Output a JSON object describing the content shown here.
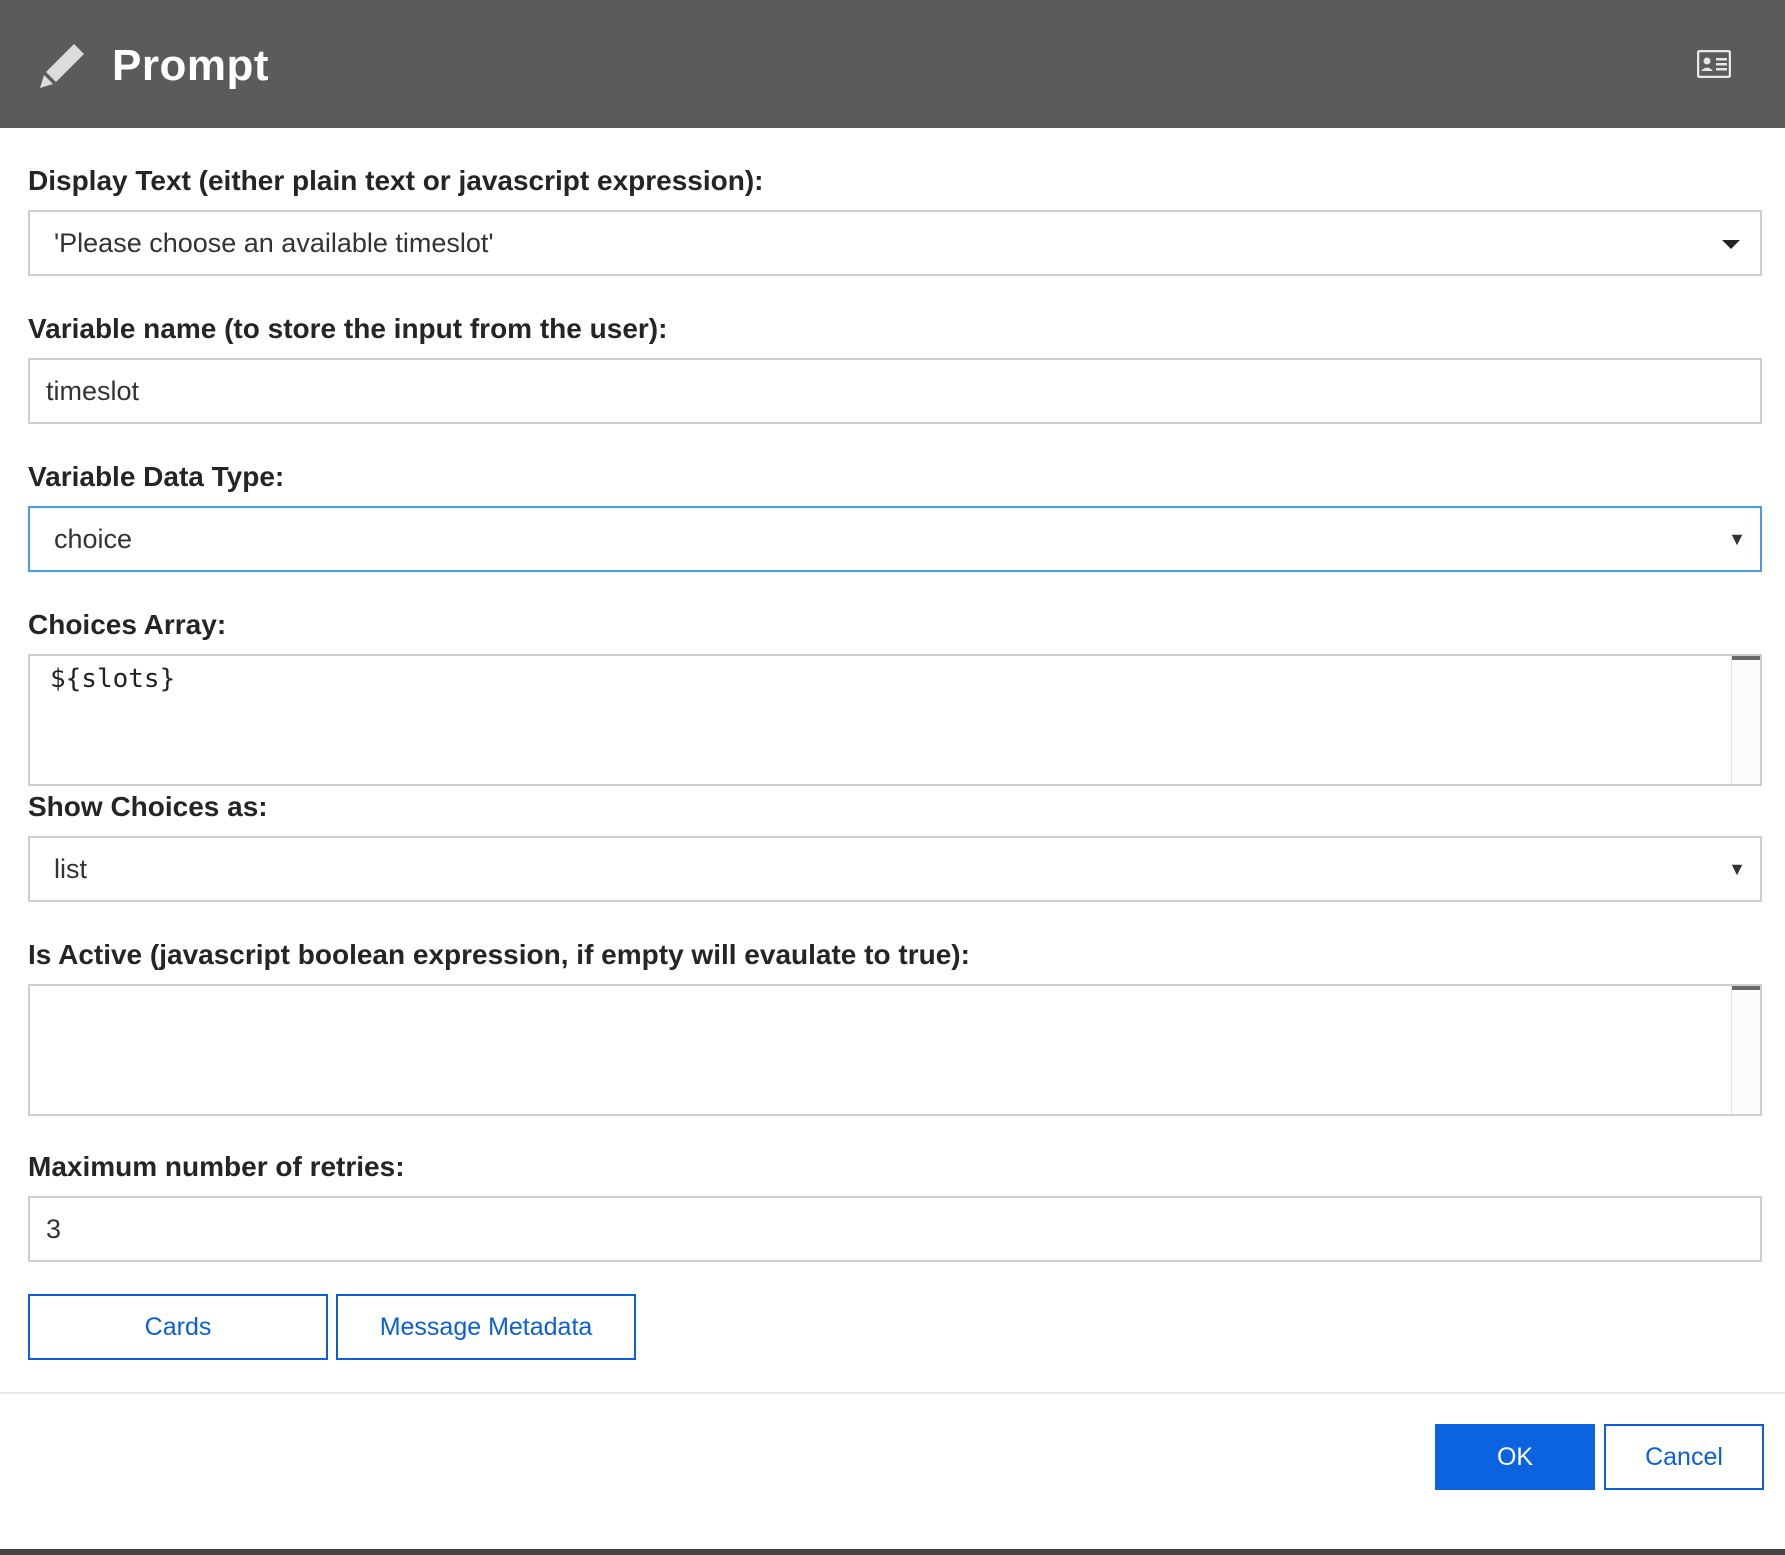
{
  "dialog": {
    "title": "Prompt",
    "title_icon": "pencil-icon",
    "header_action_icon": "contact-card-icon",
    "header_bg": "#5b5b5b"
  },
  "fields": {
    "display_text": {
      "label": "Display Text (either plain text or javascript expression):",
      "value": "'Please choose an available timeslot'"
    },
    "variable_name": {
      "label": "Variable name (to store the input from the user):",
      "value": "timeslot"
    },
    "variable_data_type": {
      "label": "Variable Data Type:",
      "value": "choice"
    },
    "choices_array": {
      "label": "Choices Array:",
      "value": "${slots}"
    },
    "show_choices_as": {
      "label": "Show Choices as:",
      "value": "list"
    },
    "is_active": {
      "label": "Is Active (javascript boolean expression, if empty will evaulate to true):",
      "value": ""
    },
    "max_retries": {
      "label": "Maximum number of retries:",
      "value": "3"
    }
  },
  "buttons": {
    "cards": "Cards",
    "message_metadata": "Message Metadata",
    "ok": "OK",
    "cancel": "Cancel"
  },
  "colors": {
    "accent": "#0b63e0",
    "focus_border": "#4a9ae6"
  }
}
